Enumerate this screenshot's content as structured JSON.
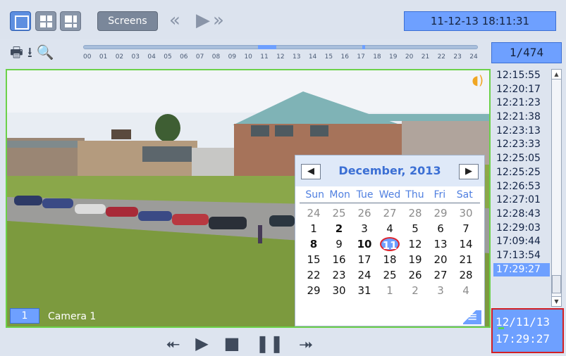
{
  "toolbar": {
    "screens_label": "Screens",
    "rewind_icon": "«",
    "play_icon": "▶",
    "forward_icon": "»",
    "datetime": "11-12-13  18:11:31"
  },
  "tools": {
    "print_icon": "🖶",
    "download_icon": "⭳",
    "search_icon": "🔍"
  },
  "timeline": {
    "hours": [
      "00",
      "01",
      "02",
      "03",
      "04",
      "05",
      "06",
      "07",
      "08",
      "09",
      "10",
      "11",
      "12",
      "13",
      "14",
      "15",
      "16",
      "17",
      "18",
      "19",
      "20",
      "21",
      "22",
      "23",
      "24"
    ]
  },
  "counter": "1/474",
  "camera": {
    "number": "1",
    "name": "Camera 1"
  },
  "calendar": {
    "prev_label": "◀",
    "next_label": "▶",
    "title": "December, 2013",
    "weekdays": [
      "Sun",
      "Mon",
      "Tue",
      "Wed",
      "Thu",
      "Fri",
      "Sat"
    ],
    "days": [
      {
        "d": "24",
        "s": "muted"
      },
      {
        "d": "25",
        "s": "muted"
      },
      {
        "d": "26",
        "s": "muted"
      },
      {
        "d": "27",
        "s": "muted"
      },
      {
        "d": "28",
        "s": "muted"
      },
      {
        "d": "29",
        "s": "muted"
      },
      {
        "d": "30",
        "s": "muted"
      },
      {
        "d": "1",
        "s": ""
      },
      {
        "d": "2",
        "s": "bold"
      },
      {
        "d": "3",
        "s": ""
      },
      {
        "d": "4",
        "s": ""
      },
      {
        "d": "5",
        "s": ""
      },
      {
        "d": "6",
        "s": ""
      },
      {
        "d": "7",
        "s": ""
      },
      {
        "d": "8",
        "s": "bold"
      },
      {
        "d": "9",
        "s": ""
      },
      {
        "d": "10",
        "s": "bold"
      },
      {
        "d": "11",
        "s": "today"
      },
      {
        "d": "12",
        "s": ""
      },
      {
        "d": "13",
        "s": ""
      },
      {
        "d": "14",
        "s": ""
      },
      {
        "d": "15",
        "s": ""
      },
      {
        "d": "16",
        "s": ""
      },
      {
        "d": "17",
        "s": ""
      },
      {
        "d": "18",
        "s": ""
      },
      {
        "d": "19",
        "s": ""
      },
      {
        "d": "20",
        "s": ""
      },
      {
        "d": "21",
        "s": ""
      },
      {
        "d": "22",
        "s": ""
      },
      {
        "d": "23",
        "s": ""
      },
      {
        "d": "24",
        "s": ""
      },
      {
        "d": "25",
        "s": ""
      },
      {
        "d": "26",
        "s": ""
      },
      {
        "d": "27",
        "s": ""
      },
      {
        "d": "28",
        "s": ""
      },
      {
        "d": "29",
        "s": ""
      },
      {
        "d": "30",
        "s": ""
      },
      {
        "d": "31",
        "s": ""
      },
      {
        "d": "1",
        "s": "muted"
      },
      {
        "d": "2",
        "s": "muted"
      },
      {
        "d": "3",
        "s": "muted"
      },
      {
        "d": "4",
        "s": "muted"
      }
    ],
    "menu_icon": "≡"
  },
  "times": [
    "12:15:55",
    "12:20:17",
    "12:21:23",
    "12:21:38",
    "12:23:13",
    "12:23:33",
    "12:25:05",
    "12:25:25",
    "12:26:53",
    "12:27:01",
    "12:28:43",
    "12:29:03",
    "17:09:44",
    "17:13:54",
    "17:29:27"
  ],
  "selected_time_index": 14,
  "playback": {
    "prev_icon": "⯬",
    "play_icon": "▶",
    "stop_icon": "■",
    "pause_icon": "❚❚",
    "next_icon": "⯮"
  },
  "readout": {
    "date": "12/11/13",
    "time": "17:29:27"
  },
  "colors": {
    "accent": "#6ea0ff",
    "frame_border": "#6cd14a",
    "highlight_border": "#d21f24"
  }
}
